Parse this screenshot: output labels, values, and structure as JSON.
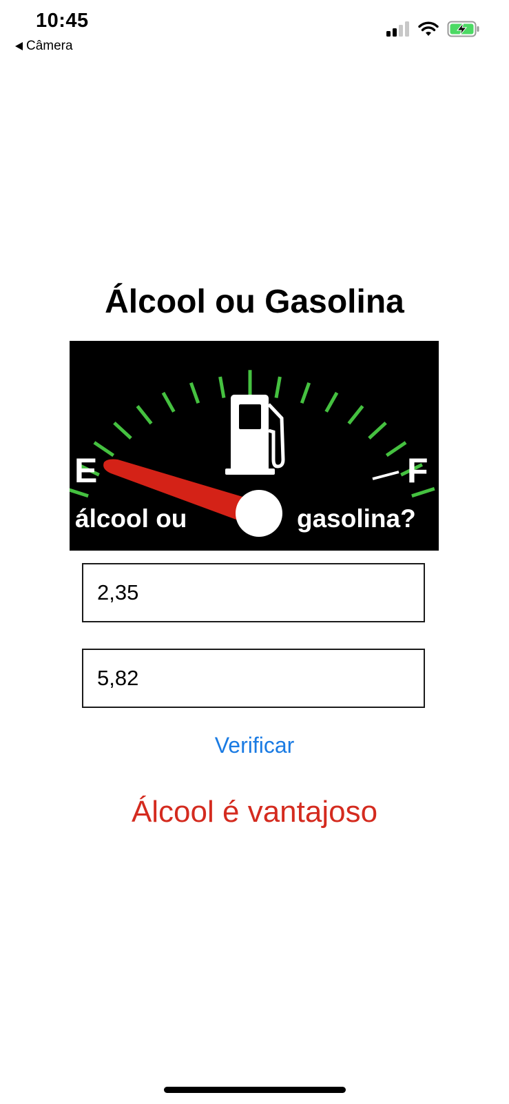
{
  "status_bar": {
    "time": "10:45",
    "back_label": "Câmera"
  },
  "page": {
    "title": "Álcool ou Gasolina"
  },
  "banner": {
    "empty_label": "E",
    "full_label": "F",
    "left_text": "álcool ou",
    "right_text": "gasolina?",
    "tick_color": "#45c140",
    "needle_color": "#d42217"
  },
  "form": {
    "alcool_price": "2,35",
    "gasolina_price": "5,82",
    "verify_label": "Verificar"
  },
  "result": {
    "text": "Álcool é vantajoso",
    "color": "#d42b1f"
  },
  "colors": {
    "link": "#1a7be3",
    "battery_fill": "#4cd964"
  }
}
